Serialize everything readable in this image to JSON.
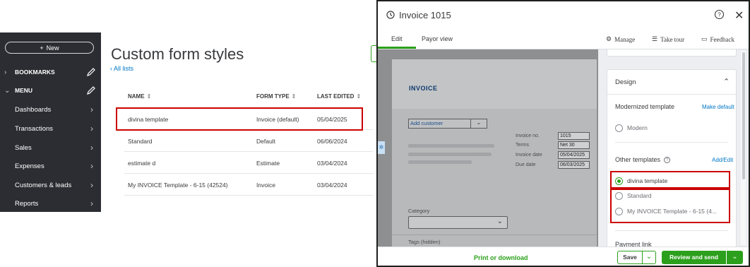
{
  "sidebar": {
    "new_button": "New",
    "new_icon": "plus-icon",
    "items": [
      {
        "label": "BOOKMARKS",
        "caret": "›",
        "action": "pencil-icon"
      },
      {
        "label": "MENU",
        "caret": "⌄",
        "action": "pencil-icon"
      },
      {
        "label": "Dashboards",
        "chevron": "›"
      },
      {
        "label": "Transactions",
        "chevron": "›"
      },
      {
        "label": "Sales",
        "chevron": "›"
      },
      {
        "label": "Expenses",
        "chevron": "›"
      },
      {
        "label": "Customers & leads",
        "chevron": "›"
      },
      {
        "label": "Reports",
        "chevron": "›"
      }
    ]
  },
  "form_styles": {
    "title": "Custom form styles",
    "back_link": "All lists",
    "columns": [
      "NAME",
      "FORM TYPE",
      "LAST EDITED"
    ],
    "sort_icon": "⇕",
    "rows": [
      {
        "name": "divina template",
        "type": "Invoice (default)",
        "edited": "05/04/2025"
      },
      {
        "name": "Standard",
        "type": "Default",
        "edited": "06/06/2024"
      },
      {
        "name": "estimate d",
        "type": "Estimate",
        "edited": "03/04/2024"
      },
      {
        "name": "My INVOICE Template - 6-15 (42524)",
        "type": "Invoice",
        "edited": "03/04/2024"
      }
    ]
  },
  "invoice_panel": {
    "title": "Invoice 1015",
    "tabs": [
      "Edit",
      "Payor view"
    ],
    "tools": [
      "Manage",
      "Take tour",
      "Feedback"
    ],
    "preview": {
      "heading": "INVOICE",
      "add_customer": "Add customer",
      "meta": [
        {
          "label": "Invoice no.",
          "value": "1015"
        },
        {
          "label": "Terms",
          "value": "Net 30"
        },
        {
          "label": "Invoice date",
          "value": "05/04/2025"
        },
        {
          "label": "Due date",
          "value": "06/03/2025"
        }
      ],
      "category_label": "Category",
      "tags_label": "Tags (hidden)"
    },
    "design": {
      "title": "Design",
      "modernized_label": "Modernized template",
      "make_default": "Make default",
      "modern_option": "Modern",
      "other_label": "Other templates",
      "add_edit": "Add/Edit",
      "options": [
        "divina template",
        "Standard",
        "My INVOICE Template - 6-15 (4..."
      ],
      "selected": "divina template",
      "payment_link": "Payment link"
    },
    "footer": {
      "print": "Print or download",
      "save": "Save",
      "send": "Review and send"
    }
  },
  "colors": {
    "brand_green": "#2ca01c",
    "highlight_red": "#cc0000",
    "sidebar_bg": "#2b2d33",
    "link_blue": "#0077c5"
  }
}
